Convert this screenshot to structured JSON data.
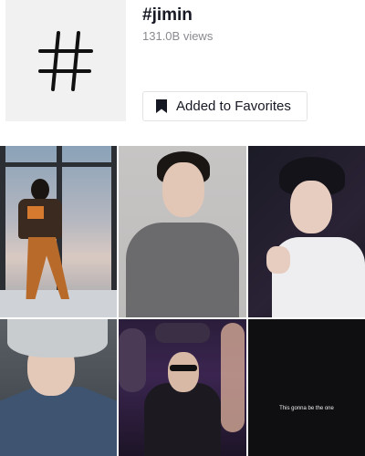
{
  "hashtag": {
    "name": "#jimin",
    "views": "131.0B views",
    "icon": "hash-icon"
  },
  "favorites_button": {
    "label": "Added to Favorites",
    "icon": "bookmark-icon"
  },
  "videos": [
    {
      "caption": ""
    },
    {
      "caption": ""
    },
    {
      "caption": ""
    },
    {
      "caption": ""
    },
    {
      "caption": ""
    },
    {
      "caption": "This gonna be the one"
    }
  ],
  "colors": {
    "title_text": "#161823",
    "secondary_text": "#8a8b91",
    "tile_background": "#f1f1f2",
    "button_border": "#e3e3e4"
  }
}
